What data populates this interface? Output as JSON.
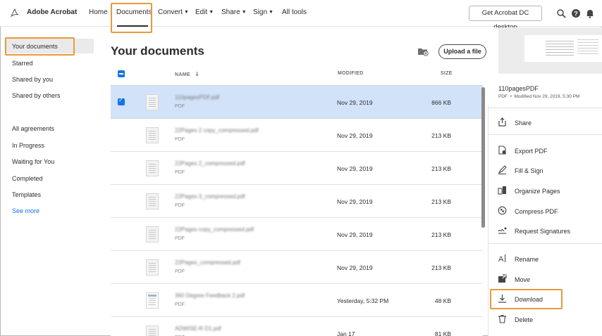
{
  "app": {
    "brand": "Adobe Acrobat"
  },
  "nav": {
    "items": [
      {
        "label": "Home",
        "has_menu": false
      },
      {
        "label": "Documents",
        "has_menu": false,
        "active": true
      },
      {
        "label": "Convert",
        "has_menu": true
      },
      {
        "label": "Edit",
        "has_menu": true
      },
      {
        "label": "Share",
        "has_menu": true
      },
      {
        "label": "Sign",
        "has_menu": true
      },
      {
        "label": "All tools",
        "has_menu": false
      }
    ],
    "cta": "Get Acrobat DC desktop",
    "icons": [
      "search-icon",
      "help-icon",
      "bell-icon"
    ]
  },
  "sidebar": {
    "items": [
      {
        "label": "Your documents",
        "active": true
      },
      {
        "label": "Starred"
      },
      {
        "label": "Shared by you"
      },
      {
        "label": "Shared by others"
      },
      {
        "label": "All agreements"
      },
      {
        "label": "In Progress"
      },
      {
        "label": "Waiting for You"
      },
      {
        "label": "Completed"
      },
      {
        "label": "Templates"
      },
      {
        "label": "See more"
      }
    ]
  },
  "main": {
    "title": "Your documents",
    "upload_label": "Upload a file",
    "columns": {
      "name": "NAME",
      "modified": "MODIFIED",
      "size": "SIZE"
    },
    "sort_icon": "arrow-down-icon",
    "rows": [
      {
        "name": "110pagesPDF.pdf",
        "type": "PDF",
        "modified": "Nov 29, 2019",
        "size": "866 KB",
        "selected": true
      },
      {
        "name": "22Pages 2 copy_compressed.pdf",
        "type": "PDF",
        "modified": "Nov 29, 2019",
        "size": "213 KB"
      },
      {
        "name": "22Pages 2_compressed.pdf",
        "type": "PDF",
        "modified": "Nov 29, 2019",
        "size": "213 KB"
      },
      {
        "name": "22Pages 3_compressed.pdf",
        "type": "PDF",
        "modified": "Nov 29, 2019",
        "size": "213 KB"
      },
      {
        "name": "22Pages copy_compressed.pdf",
        "type": "PDF",
        "modified": "Nov 29, 2019",
        "size": "213 KB"
      },
      {
        "name": "22Pages_compressed.pdf",
        "type": "PDF",
        "modified": "Nov 29, 2019",
        "size": "213 KB"
      },
      {
        "name": "360 Degree Feedback 2.pdf",
        "type": "PDF",
        "modified": "Yesterday, 5:32 PM",
        "size": "48 KB"
      },
      {
        "name": "ADWISE-R D1.pdf",
        "type": "PDF",
        "modified": "Jan 17",
        "size": "81 KB"
      }
    ]
  },
  "details": {
    "file_name": "110pagesPDF",
    "type": "PDF",
    "modified_text": "Modified  Nov 29, 2019, 5:30 PM",
    "actions": [
      {
        "label": "Share",
        "icon": "share-icon"
      },
      {
        "label": "Export PDF",
        "icon": "export-pdf-icon"
      },
      {
        "label": "Fill & Sign",
        "icon": "fill-sign-icon"
      },
      {
        "label": "Organize Pages",
        "icon": "organize-pages-icon"
      },
      {
        "label": "Compress PDF",
        "icon": "compress-pdf-icon"
      },
      {
        "label": "Request Signatures",
        "icon": "request-signatures-icon"
      },
      {
        "label": "Rename",
        "icon": "rename-icon"
      },
      {
        "label": "Move",
        "icon": "move-icon"
      },
      {
        "label": "Download",
        "icon": "download-icon"
      },
      {
        "label": "Delete",
        "icon": "delete-icon"
      }
    ]
  },
  "colors": {
    "accent": "#1473e6",
    "selected_row": "#d2e3f9",
    "highlight": "#e8993c",
    "brand": "#ed1c24"
  }
}
